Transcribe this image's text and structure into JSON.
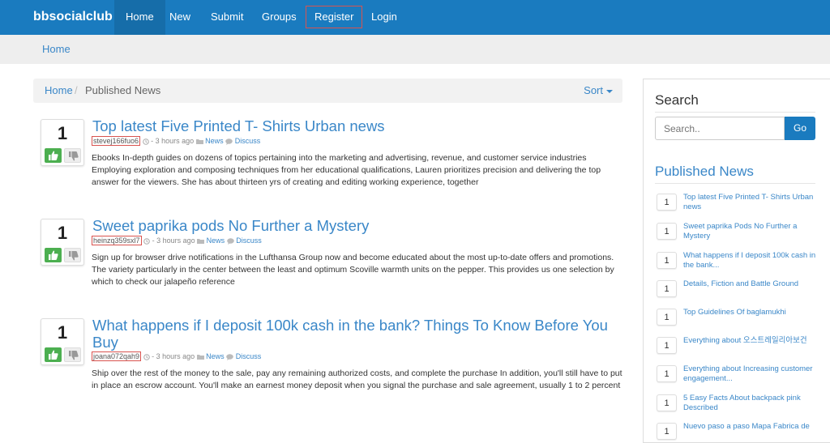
{
  "navbar": {
    "brand": "bbsocialclub",
    "items": [
      {
        "label": "Home"
      },
      {
        "label": "New"
      },
      {
        "label": "Submit"
      },
      {
        "label": "Groups"
      },
      {
        "label": "Register"
      },
      {
        "label": "Login"
      }
    ]
  },
  "subbar": {
    "link": "Home"
  },
  "breadcrumb": {
    "home": "Home",
    "separator": "/",
    "current": "Published News",
    "sort": "Sort"
  },
  "posts": [
    {
      "votes": "1",
      "title": "Top latest Five Printed T- Shirts Urban news",
      "user": "stevej166fuo6",
      "time": "- 3 hours ago",
      "category": "News",
      "discuss": "Discuss",
      "body": "Ebooks In-depth guides on dozens of topics pertaining into the marketing and advertising, revenue, and customer service industries Employing exploration and composing techniques from her educational qualifications, Lauren prioritizes precision and delivering the top answer for the viewers. She has about thirteen yrs of creating and editing working experience, together"
    },
    {
      "votes": "1",
      "title": "Sweet paprika pods No Further a Mystery",
      "user": "heinzq359sxl7",
      "time": "- 3 hours ago",
      "category": "News",
      "discuss": "Discuss",
      "body": "Sign up for browser drive notifications in the Lufthansa Group now and become educated about the most up-to-date offers and promotions. The variety particularly in the center between the least and optimum Scoville warmth units on the pepper. This provides us one selection by which to check our jalapeño reference"
    },
    {
      "votes": "1",
      "title": "What happens if I deposit 100k cash in the bank? Things To Know Before You Buy",
      "user": "joana072qah9",
      "time": "- 3 hours ago",
      "category": "News",
      "discuss": "Discuss",
      "body": "Ship over the rest of the money to the sale, pay any remaining authorized costs, and complete the purchase In addition, you'll still have to put in place an escrow account. You'll make an earnest money deposit when you signal the purchase and sale agreement, usually 1 to 2 percent"
    }
  ],
  "sidebar": {
    "search_title": "Search",
    "search_placeholder": "Search..",
    "search_button": "Go",
    "published_title": "Published News",
    "items": [
      {
        "count": "1",
        "text": "Top latest Five Printed T- Shirts Urban news"
      },
      {
        "count": "1",
        "text": "Sweet paprika Pods No Further a Mystery"
      },
      {
        "count": "1",
        "text": "What happens if I deposit 100k cash in the bank..."
      },
      {
        "count": "1",
        "text": "Details, Fiction and Battle Ground"
      },
      {
        "count": "1",
        "text": "Top Guidelines Of baglamukhi"
      },
      {
        "count": "1",
        "text": "Everything about 오스트레일리아보건"
      },
      {
        "count": "1",
        "text": "Everything about Increasing customer engagement..."
      },
      {
        "count": "1",
        "text": "5 Easy Facts About backpack pink Described"
      },
      {
        "count": "1",
        "text": "Nuevo paso a paso Mapa Fabrica de"
      }
    ]
  },
  "colors": {
    "brand": "#1a7bbf",
    "link": "#3a87c8",
    "upvote": "#4caf50"
  }
}
